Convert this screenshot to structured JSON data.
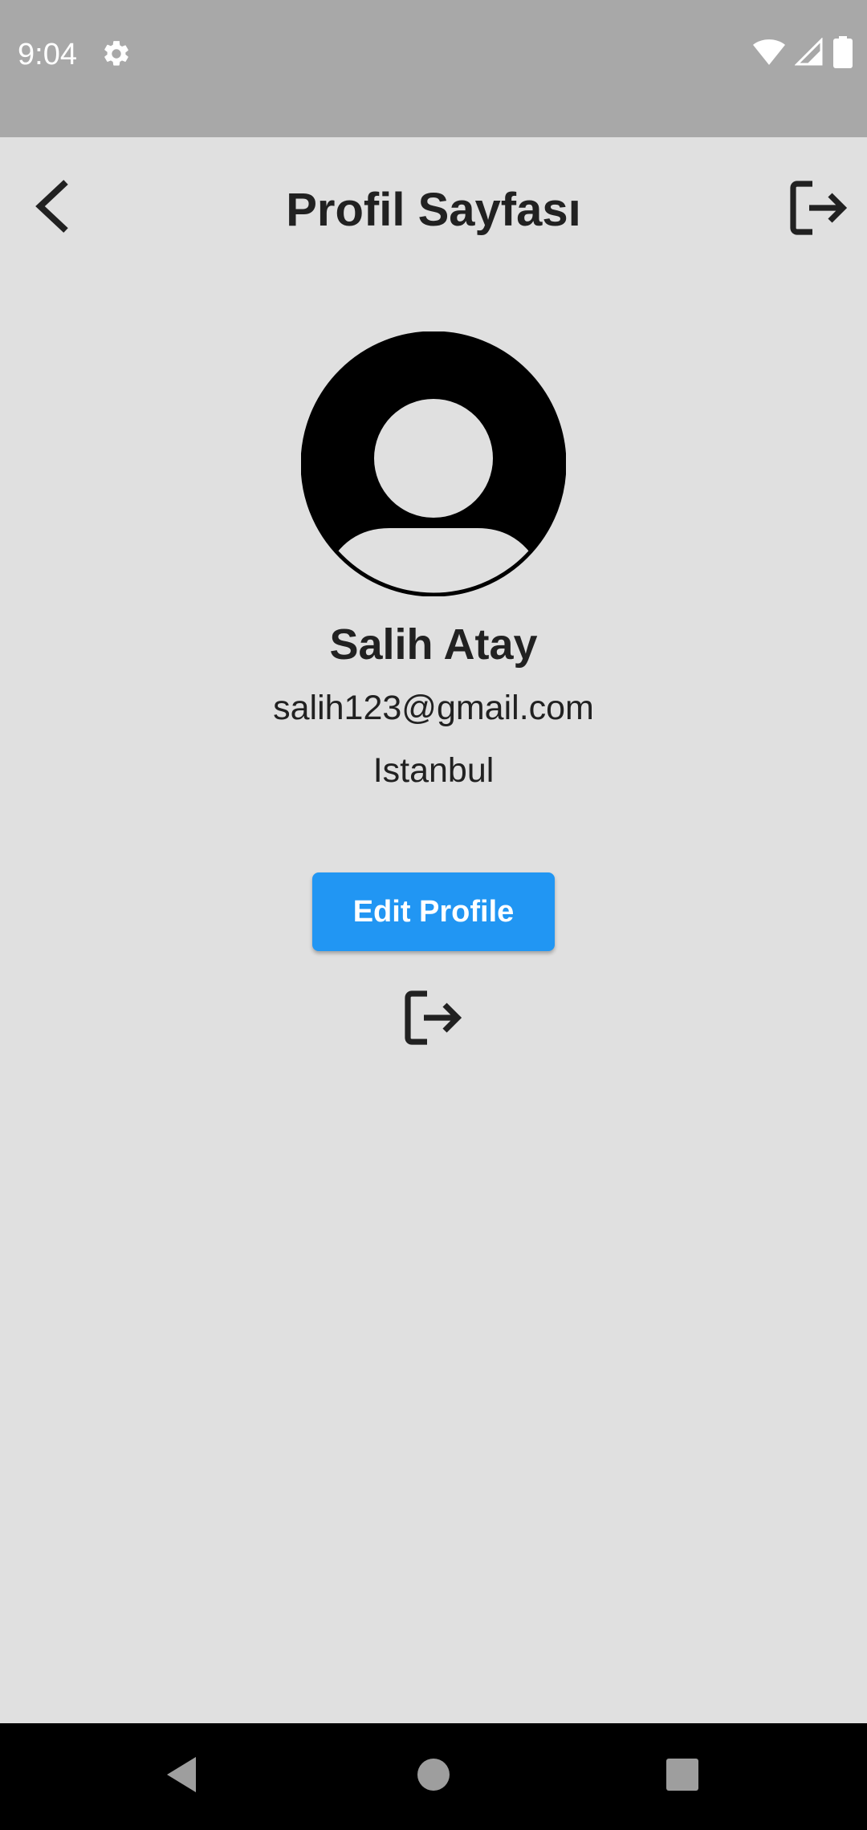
{
  "status_bar": {
    "time": "9:04",
    "icons": [
      "settings-icon",
      "wifi-icon",
      "signal-icon",
      "battery-icon"
    ]
  },
  "app_bar": {
    "title": "Profil Sayfası",
    "back_icon": "arrow-back-icon",
    "logout_icon": "logout-icon"
  },
  "profile": {
    "avatar_icon": "account-circle-icon",
    "name": "Salih Atay",
    "email": "salih123@gmail.com",
    "city": "Istanbul"
  },
  "actions": {
    "edit_label": "Edit Profile",
    "logout_icon": "logout-icon"
  },
  "nav_bar": {
    "icons": [
      "nav-back-icon",
      "nav-home-icon",
      "nav-recents-icon"
    ]
  },
  "colors": {
    "status_bar": "#a8a8a8",
    "background": "#e0e0e0",
    "accent": "#2196f3",
    "text": "#212121",
    "nav_bar": "#000000"
  }
}
